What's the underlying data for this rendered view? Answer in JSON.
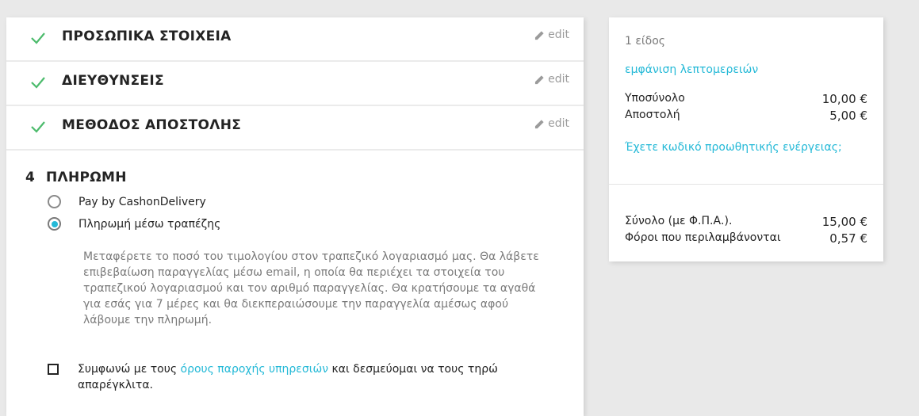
{
  "steps": [
    {
      "title": "ΠΡΟΣΩΠΙΚΑ ΣΤΟΙΧΕΙΑ",
      "edit": "edit"
    },
    {
      "title": "ΔΙΕΥΘΥΝΣΕΙΣ",
      "edit": "edit"
    },
    {
      "title": "ΜΕΘΟΔΟΣ ΑΠΟΣΤΟΛΗΣ",
      "edit": "edit"
    }
  ],
  "payment": {
    "number": "4",
    "title": "ΠΛΗΡΩΜΗ",
    "options": [
      {
        "label": "Pay by CashonDelivery",
        "selected": false
      },
      {
        "label": "Πληρωμή μέσω τραπέζης",
        "selected": true
      }
    ],
    "description": "Μεταφέρετε το ποσό του τιμολογίου στον τραπεζικό λογαριασμό μας. Θα λάβετε επιβεβαίωση παραγγελίας μέσω email, η οποία θα περιέχει τα στοιχεία του τραπεζικού λογαριασμού και τον αριθμό παραγγελίας. Θα κρατήσουμε τα αγαθά για εσάς για 7 μέρες και θα διεκπεραιώσουμε την παραγγελία αμέσως αφού λάβουμε την πληρωμή.",
    "terms_prefix": "Συμφωνώ με τους ",
    "terms_link": "όρους παροχής υπηρεσιών",
    "terms_suffix": " και δεσμεύομαι να τους τηρώ απαρέγκλιτα."
  },
  "summary": {
    "items_count": "1 είδος",
    "show_details": "εμφάνιση λεπτομερειών",
    "subtotal_label": "Υποσύνολο",
    "subtotal_value": "10,00 €",
    "shipping_label": "Αποστολή",
    "shipping_value": "5,00 €",
    "promo": "Έχετε κωδικό προωθητικής ενέργειας;",
    "total_label": "Σύνολο (με Φ.Π.Α.).",
    "total_value": "15,00 €",
    "tax_label": "Φόροι που περιλαμβάνονται",
    "tax_value": "0,57 €"
  },
  "colors": {
    "accent": "#24b9d7",
    "check": "#4cbb6c"
  }
}
